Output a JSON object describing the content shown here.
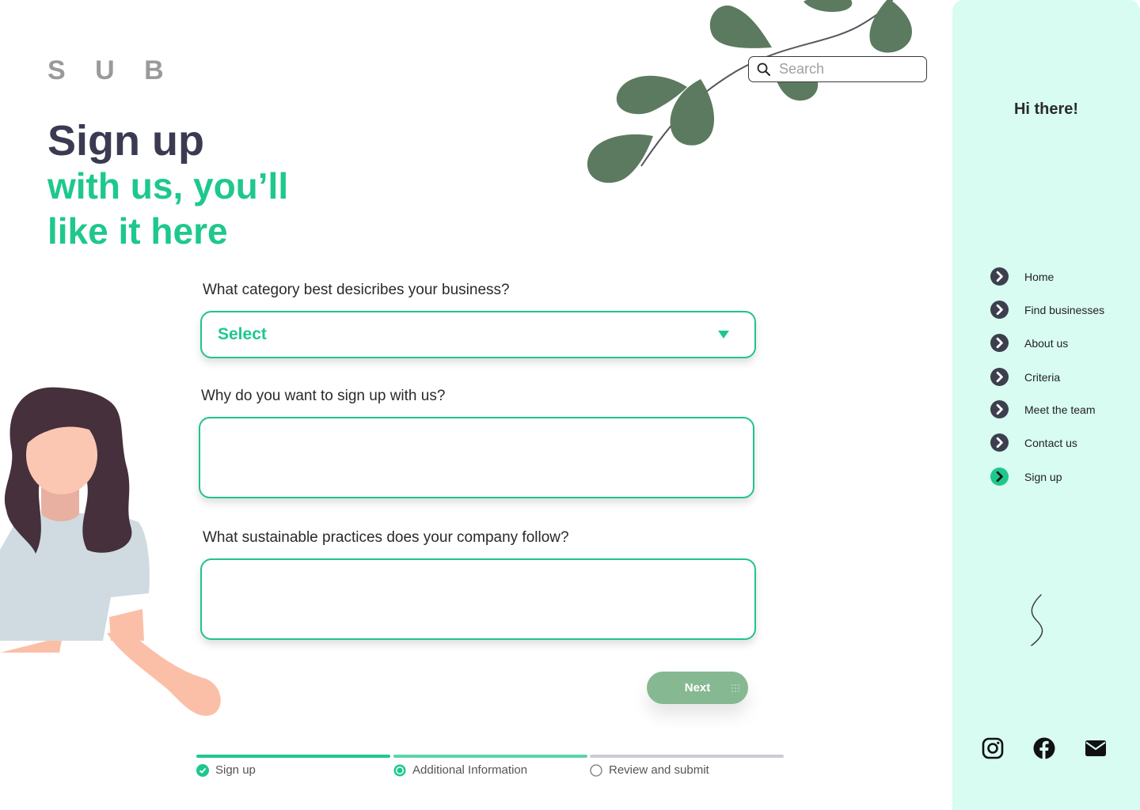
{
  "brand": {
    "logo": "S U B"
  },
  "hero": {
    "line1": "Sign up",
    "line2": "with us, you’ll",
    "line3": "like it here"
  },
  "search": {
    "placeholder": "Search"
  },
  "form": {
    "q1": {
      "label": "What category best desicribes your business?",
      "selected": "Select"
    },
    "q2": {
      "label": "Why do you want to sign up with us?",
      "value": ""
    },
    "q3": {
      "label": "What sustainable practices does your company follow?",
      "value": ""
    },
    "next_label": "Next"
  },
  "steps": [
    {
      "label": "Sign up",
      "state": "complete"
    },
    {
      "label": "Additional Information",
      "state": "current"
    },
    {
      "label": "Review and submit",
      "state": "pending"
    }
  ],
  "sidebar": {
    "greeting": "Hi there!",
    "nav": [
      {
        "label": "Home",
        "active": false
      },
      {
        "label": "Find businesses",
        "active": false
      },
      {
        "label": "About us",
        "active": false
      },
      {
        "label": "Criteria",
        "active": false
      },
      {
        "label": "Meet the team",
        "active": false
      },
      {
        "label": "Contact us",
        "active": false
      },
      {
        "label": "Sign up",
        "active": true
      }
    ],
    "socials": [
      "instagram-icon",
      "facebook-icon",
      "email-icon"
    ]
  },
  "colors": {
    "accent": "#1ec88c",
    "heading": "#3a3a52",
    "sidebar_bg": "#d8fcf1",
    "button": "#86b892",
    "leaf": "#5c7a5f"
  }
}
